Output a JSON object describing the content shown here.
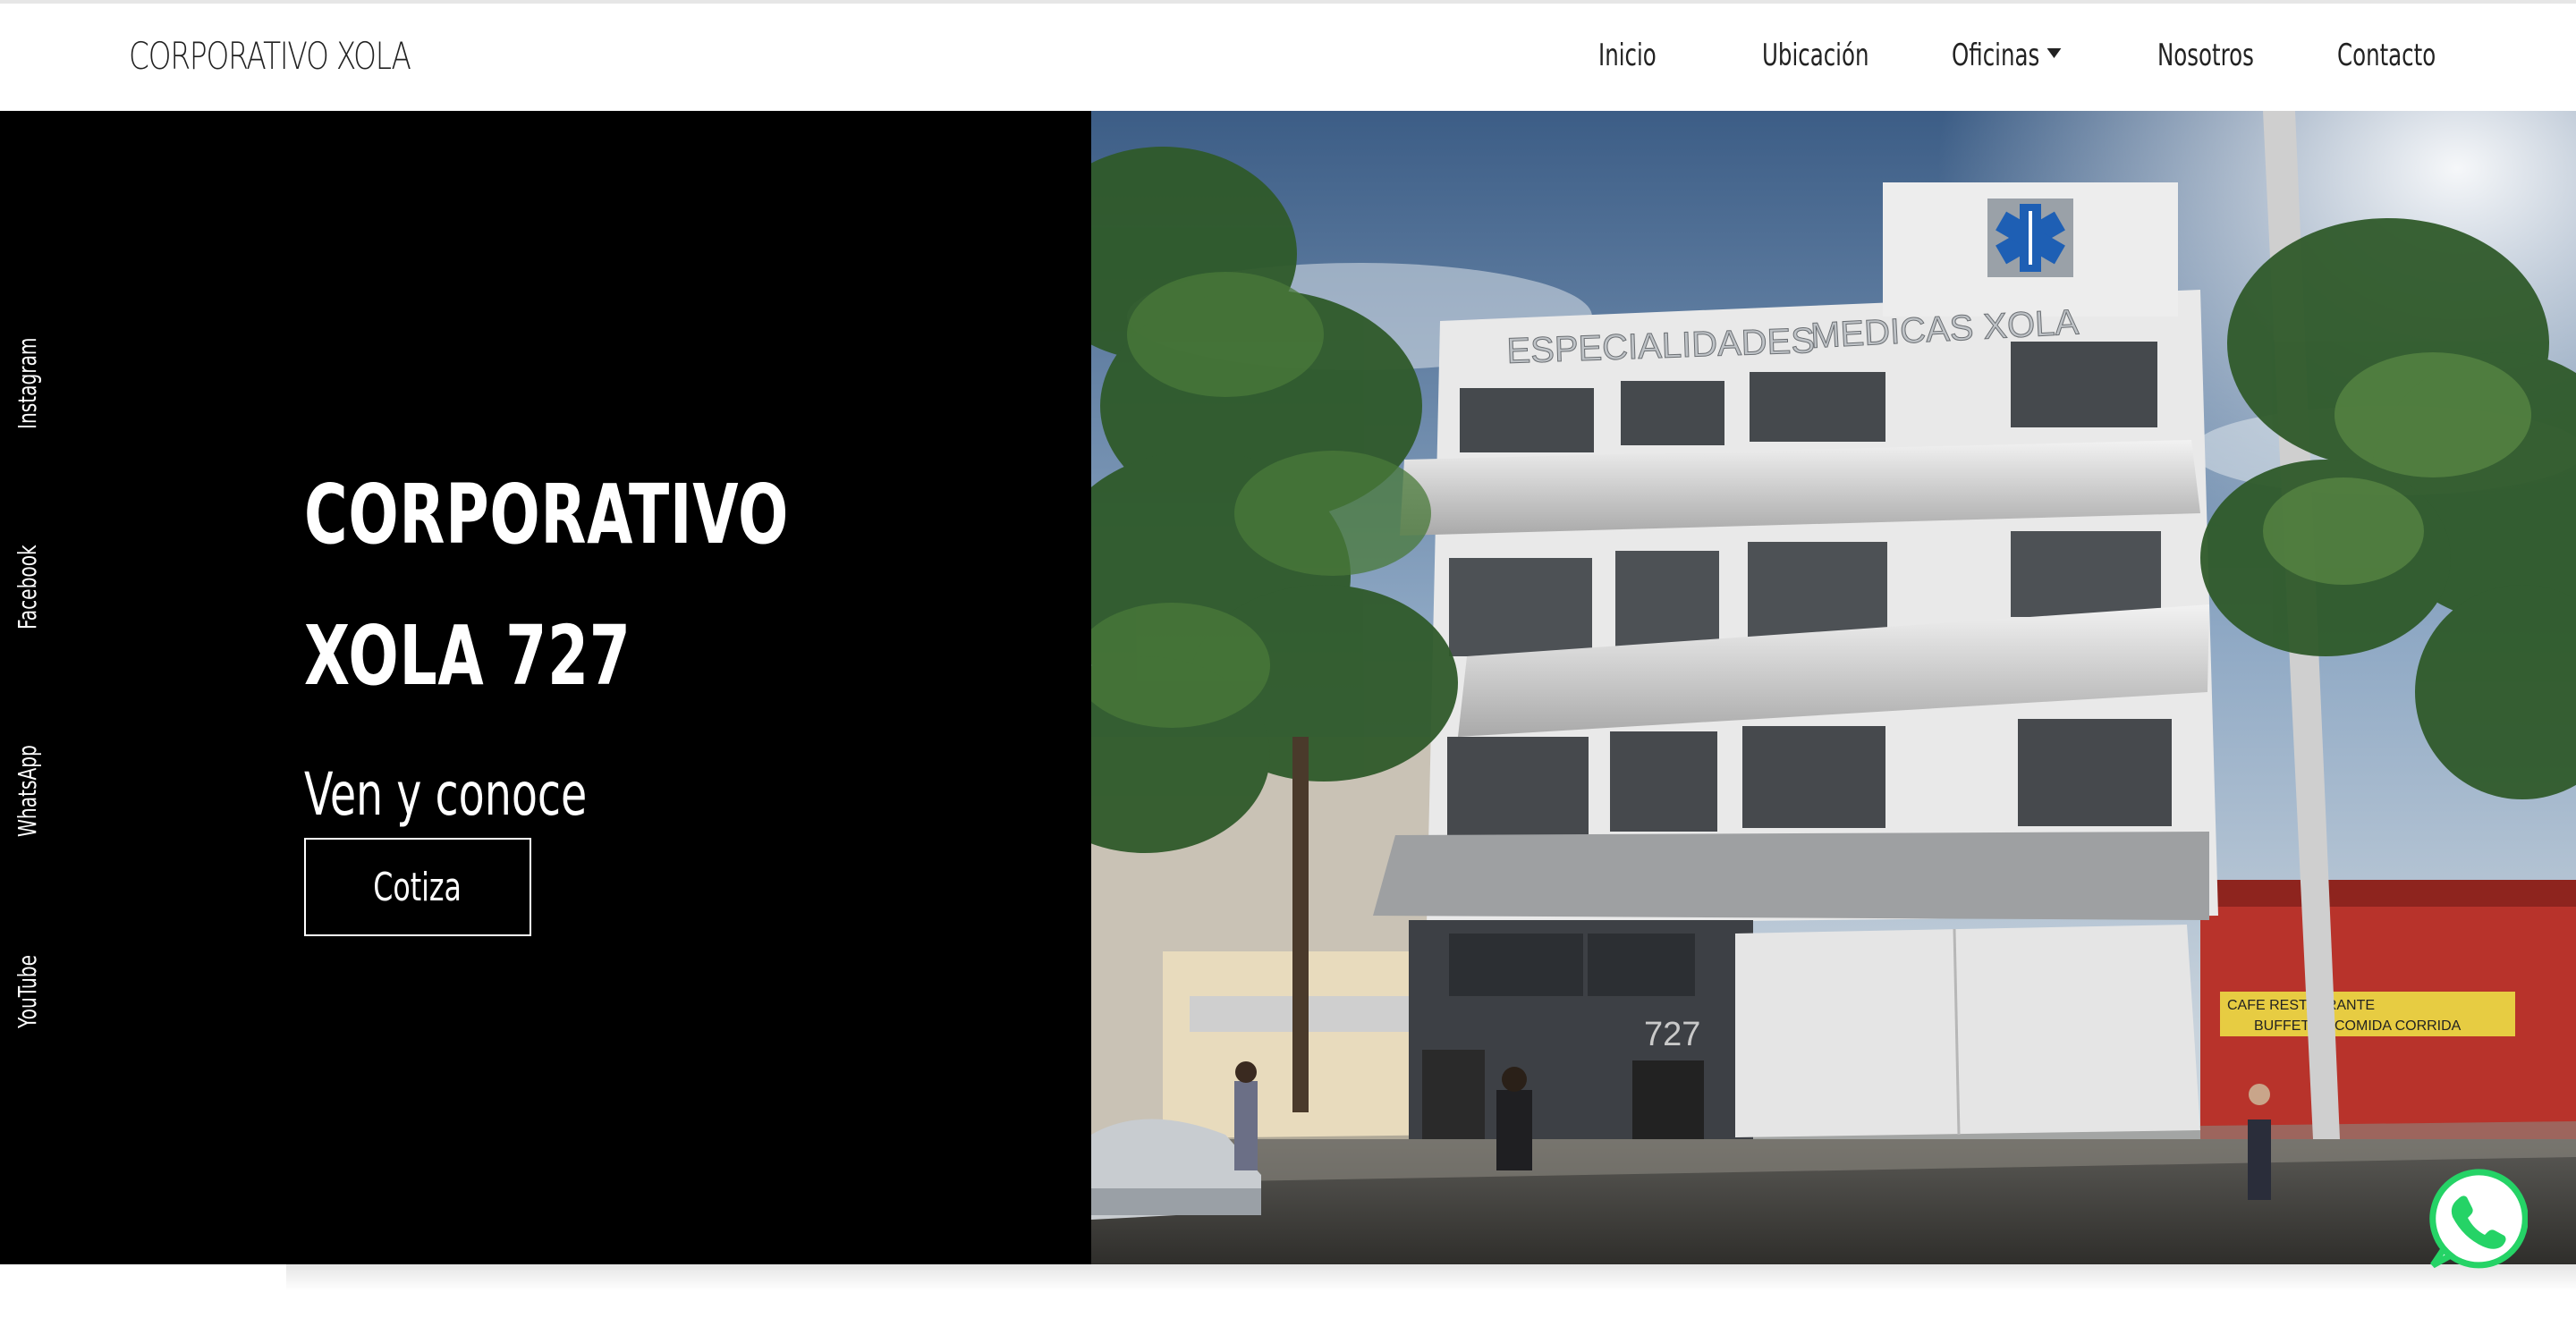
{
  "brand": "CORPORATIVO XOLA",
  "nav": {
    "items": [
      {
        "label": "Inicio"
      },
      {
        "label": "Ubicación"
      },
      {
        "label": "Oficinas",
        "dropdown": true
      },
      {
        "label": "Nosotros"
      },
      {
        "label": "Contacto"
      }
    ]
  },
  "social": [
    "Instagram",
    "Facebook",
    "WhatsApp",
    "YouTube"
  ],
  "hero": {
    "title_line1": "CORPORATIVO",
    "title_line2": "XOLA 727",
    "subtitle": "Ven y conoce",
    "cta_label": "Cotiza"
  },
  "image": {
    "sign_left": "ESPECIALIDADES",
    "sign_right": "MEDICAS XOLA",
    "street_number": "727",
    "shop_sign_1": "CAFE RESTAURANTE",
    "shop_sign_2": "BUFFET",
    "shop_sign_3": "COMIDA CORRIDA"
  },
  "colors": {
    "hero_bg": "#000000",
    "whatsapp": "#25d366",
    "text_dark": "#222222"
  },
  "icons": {
    "floating": "whatsapp-icon",
    "dropdown": "chevron-down-icon"
  }
}
